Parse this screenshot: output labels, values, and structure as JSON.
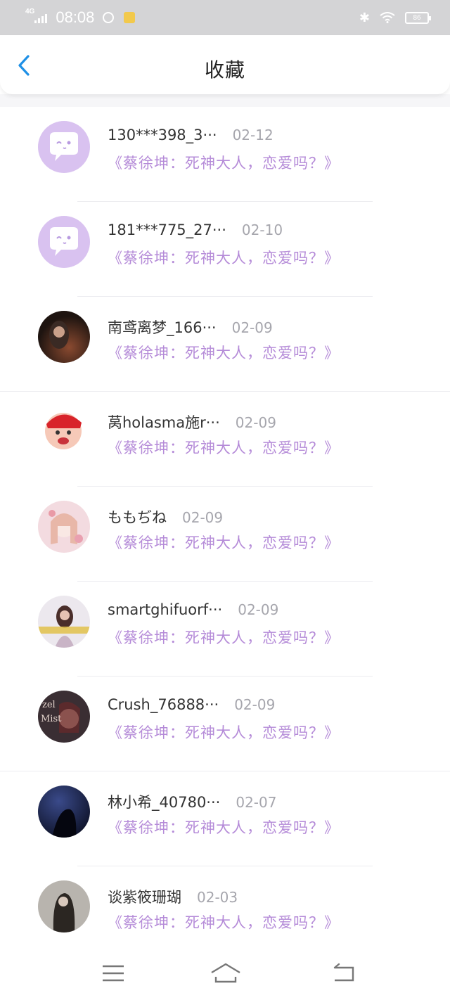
{
  "status_bar": {
    "network": "4G",
    "time": "08:08",
    "battery": "86"
  },
  "header": {
    "title": "收藏"
  },
  "favorites": [
    {
      "name": "130***398_3···",
      "date": "02-12",
      "book": "《蔡徐坤：死神大人，恋爱吗？》",
      "avatar": "default-chat-bubble"
    },
    {
      "name": "181***775_27···",
      "date": "02-10",
      "book": "《蔡徐坤：死神大人，恋爱吗？》",
      "avatar": "default-chat-bubble"
    },
    {
      "name": "南鸢离梦_166···",
      "date": "02-09",
      "book": "《蔡徐坤：死神大人，恋爱吗？》",
      "avatar": "photo-dark"
    },
    {
      "name": "莴holasma施r···",
      "date": "02-09",
      "book": "《蔡徐坤：死神大人，恋爱吗？》",
      "avatar": "cartoon-red"
    },
    {
      "name": "ももぢね",
      "date": "02-09",
      "book": "《蔡徐坤：死神大人，恋爱吗？》",
      "avatar": "anime-pink"
    },
    {
      "name": "smartghifuorf···",
      "date": "02-09",
      "book": "《蔡徐坤：死神大人，恋爱吗？》",
      "avatar": "photo-girl"
    },
    {
      "name": "Crush_76888···",
      "date": "02-09",
      "book": "《蔡徐坤：死神大人，恋爱吗？》",
      "avatar": "poster-dark"
    },
    {
      "name": "林小希_40780···",
      "date": "02-07",
      "book": "《蔡徐坤：死神大人，恋爱吗？》",
      "avatar": "photo-night"
    },
    {
      "name": "谈紫筱珊瑚",
      "date": "02-03",
      "book": "《蔡徐坤：死神大人，恋爱吗？》",
      "avatar": "photo-gray"
    }
  ],
  "colors": {
    "accent": "#1e90e6",
    "book_title": "#b58bd8",
    "default_avatar": "#d9c2f0"
  },
  "navbar": {
    "icons": [
      "menu-icon",
      "home-icon",
      "back-nav-icon"
    ]
  }
}
